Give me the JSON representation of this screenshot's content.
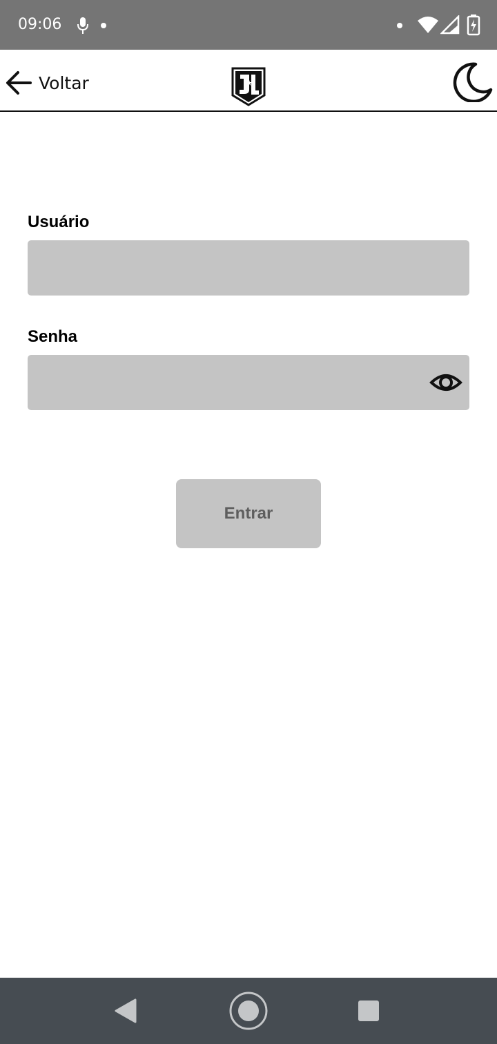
{
  "status_bar": {
    "time": "09:06",
    "icons": [
      "microphone-icon",
      "dot-icon",
      "dot-icon",
      "wifi-icon",
      "signal-icon",
      "battery-charging-icon"
    ]
  },
  "header": {
    "back_label": "Voltar",
    "back_icon": "arrow-left-icon",
    "logo_icon": "justice-league-logo",
    "theme_icon": "moon-icon"
  },
  "form": {
    "username": {
      "label": "Usuário",
      "value": "",
      "placeholder": ""
    },
    "password": {
      "label": "Senha",
      "value": "",
      "placeholder": "",
      "toggle_icon": "eye-icon"
    },
    "submit_label": "Entrar"
  },
  "nav_bar": {
    "buttons": [
      "back-triangle-icon",
      "home-circle-icon",
      "recents-square-icon"
    ]
  },
  "colors": {
    "status_bar": "#757575",
    "input_background": "#c4c4c4",
    "button_text": "#5e5e5e",
    "nav_bar": "#464c52"
  }
}
